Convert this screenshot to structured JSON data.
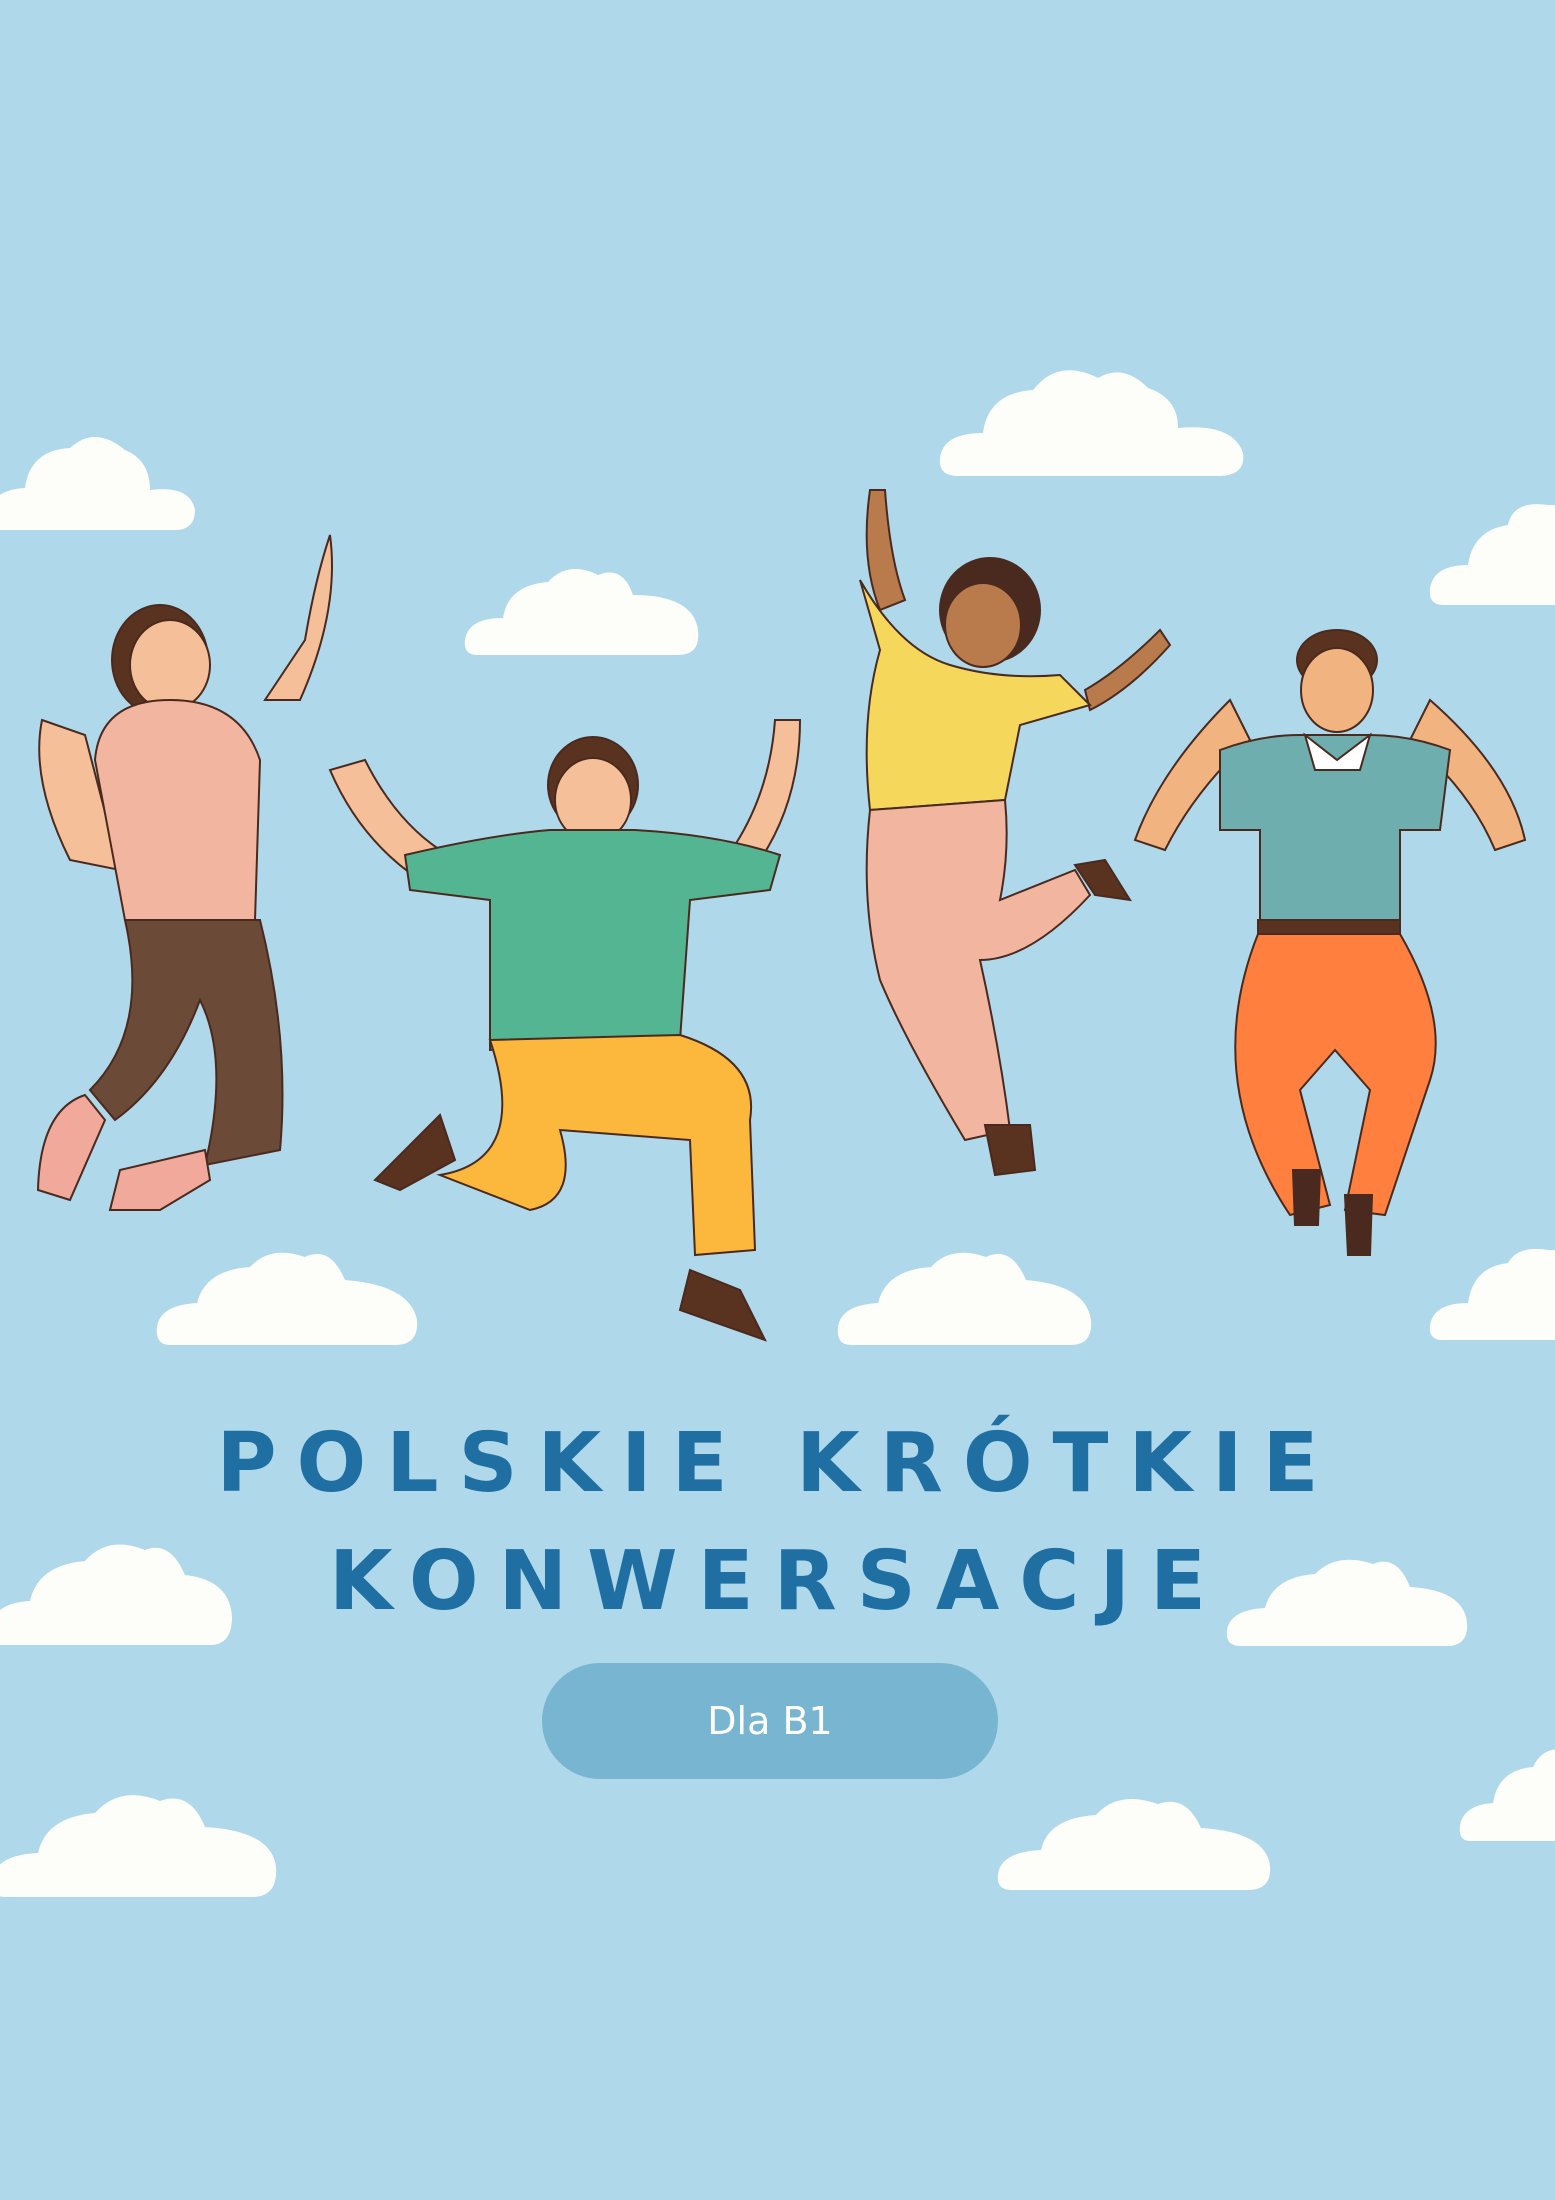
{
  "document": {
    "title_line1": "POLSKIE KRÓTKIE",
    "title_line2": "KONWERSACJE",
    "level_badge": "Dla B1"
  },
  "colors": {
    "background": "#afd8ea",
    "title": "#1f6fa3",
    "badge": "#78b5d0",
    "cloud": "#fdfdf9"
  },
  "illustration": {
    "figures": [
      "woman-pink-shirt-brown-pants",
      "man-green-shirt-yellow-pants",
      "woman-yellow-top-pink-pants",
      "man-teal-shirt-orange-pants"
    ]
  }
}
